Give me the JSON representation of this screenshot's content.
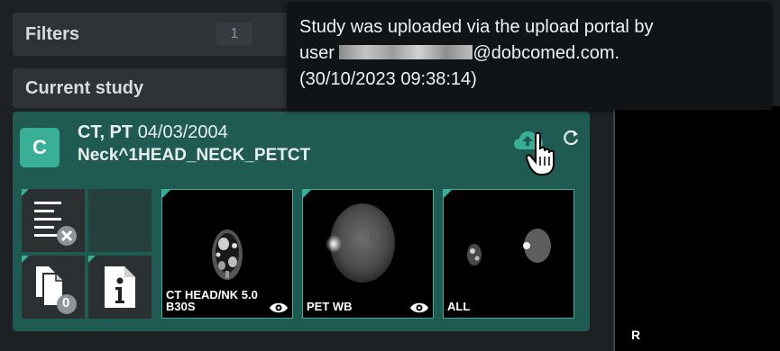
{
  "sidebar": {
    "filters": {
      "label": "Filters",
      "count": "1"
    },
    "current_study": {
      "label": "Current study"
    }
  },
  "study": {
    "avatar_letter": "C",
    "modalities": "CT, PT",
    "date": "04/03/2004",
    "description": "Neck^1HEAD_NECK_PETCT",
    "upload_icon": "cloud-upload-icon",
    "refresh_icon": "refresh-icon"
  },
  "attachments": {
    "report_icon": "report-removed-icon",
    "documents_icon": "documents-icon",
    "documents_count": "0",
    "info_icon": "info-icon"
  },
  "series": [
    {
      "label_line1": "CT HEAD/NK 5.0",
      "label_line2": "B30S",
      "eye_icon": "eye-icon"
    },
    {
      "label_line1": "PET WB",
      "label_line2": "",
      "eye_icon": "eye-icon"
    },
    {
      "label_line1": "ALL",
      "label_line2": ""
    }
  ],
  "tooltip": {
    "line1": "Study was uploaded via the upload portal by",
    "line2_prefix": "user ",
    "line2_suffix": "@dobcomed.com.",
    "line3": "(30/10/2023 09:38:14)"
  },
  "viewer": {
    "orientation": "R"
  },
  "colors": {
    "accent": "#3aaf97",
    "card": "#1f5b53",
    "panel": "#2e3336",
    "background": "#1d2124"
  }
}
